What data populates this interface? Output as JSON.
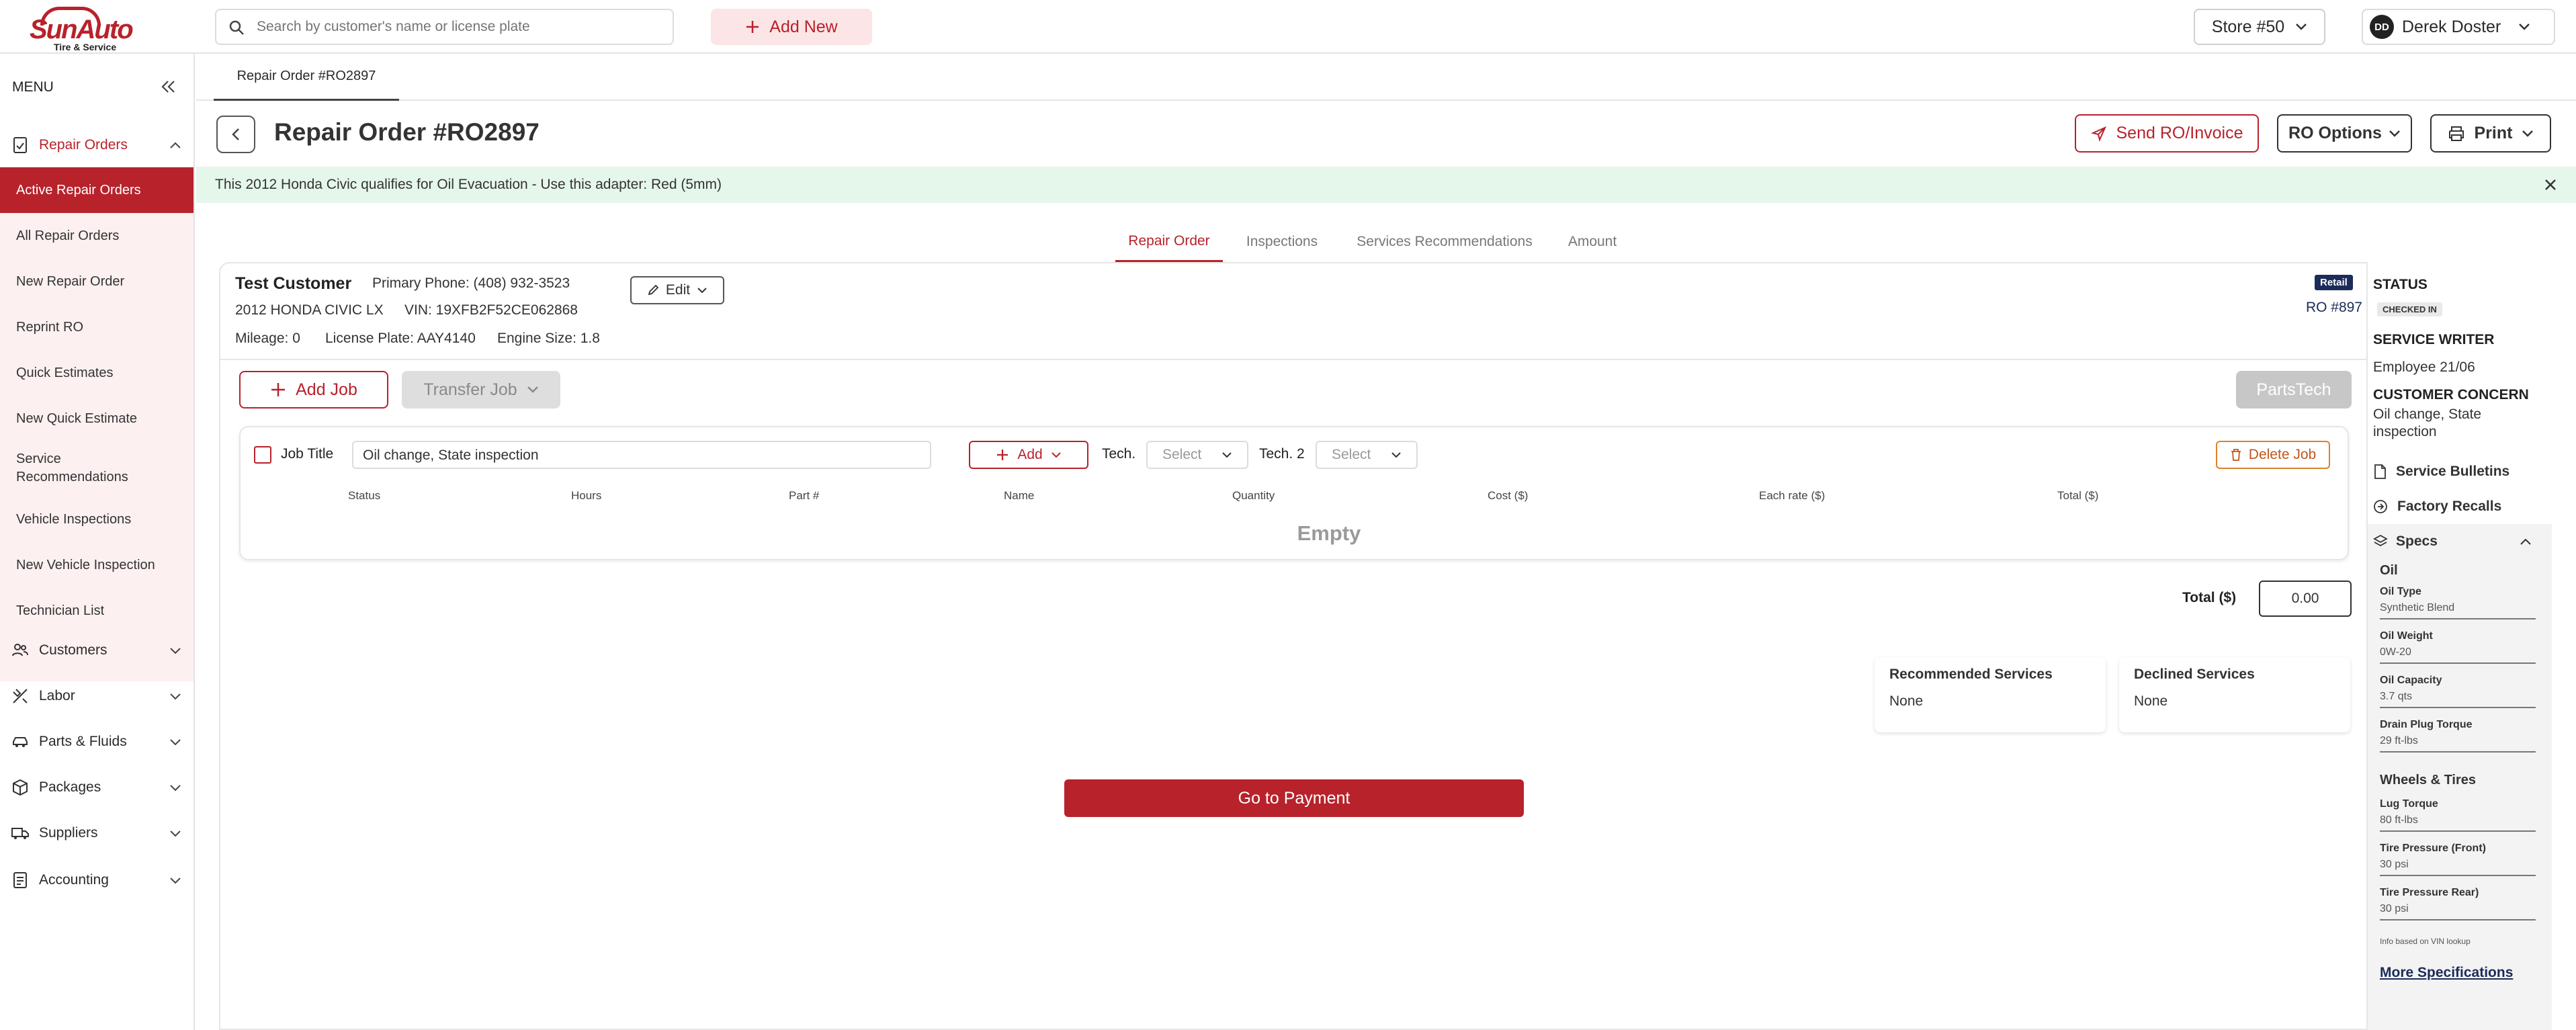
{
  "header": {
    "logo_text": "SunAuto",
    "logo_tagline": "Tire & Service",
    "search_placeholder": "Search by customer's name or license plate",
    "add_new_label": "Add New",
    "store_label": "Store #50",
    "user_initials": "DD",
    "user_name": "Derek Doster"
  },
  "sidebar": {
    "menu_label": "MENU",
    "repair_orders_label": "Repair Orders",
    "sub_items": [
      {
        "label": "Active Repair Orders",
        "active": true
      },
      {
        "label": "All Repair Orders"
      },
      {
        "label": "New Repair Order"
      },
      {
        "label": "Reprint RO"
      },
      {
        "label": "Quick Estimates"
      },
      {
        "label": "New Quick Estimate"
      },
      {
        "label": "Service Recommendations"
      },
      {
        "label": "Vehicle Inspections"
      },
      {
        "label": "New Vehicle Inspection"
      },
      {
        "label": "Technician List"
      }
    ],
    "groups": [
      {
        "label": "Customers",
        "icon": "customers-icon"
      },
      {
        "label": "Labor",
        "icon": "labor-icon"
      },
      {
        "label": "Parts & Fluids",
        "icon": "car-icon"
      },
      {
        "label": "Packages",
        "icon": "package-icon"
      },
      {
        "label": "Suppliers",
        "icon": "truck-icon"
      },
      {
        "label": "Accounting",
        "icon": "accounting-icon"
      }
    ]
  },
  "page_tab": "Repair Order #RO2897",
  "title": "Repair Order #RO2897",
  "actions": {
    "send": "Send RO/Invoice",
    "ro_options": "RO Options",
    "print": "Print"
  },
  "banner": "This 2012 Honda Civic qualifies for Oil Evacuation - Use this adapter: Red (5mm)",
  "content_tabs": [
    {
      "label": "Repair Order",
      "active": true
    },
    {
      "label": "Inspections"
    },
    {
      "label": "Services Recommendations"
    },
    {
      "label": "Amount"
    }
  ],
  "customer": {
    "name": "Test Customer",
    "phone": "Primary Phone: (408) 932-3523",
    "vehicle": "2012 HONDA CIVIC LX",
    "vin": "VIN: 19XFB2F52CE062868",
    "mileage": "Mileage: 0",
    "plate": "License Plate: AAY4140",
    "engine": "Engine Size: 1.8",
    "edit_label": "Edit",
    "type_badge": "Retail",
    "ro_number": "RO #897"
  },
  "job_actions": {
    "add_job": "Add Job",
    "transfer_job": "Transfer Job",
    "partstech": "PartsTech"
  },
  "job": {
    "title_label": "Job Title",
    "title_value": "Oil change,  State inspection",
    "add_label": "Add",
    "tech_label": "Tech.",
    "tech_select": "Select",
    "tech2_label": "Tech. 2",
    "tech2_select": "Select",
    "delete_label": "Delete Job",
    "columns": [
      "Status",
      "Hours",
      "Part #",
      "Name",
      "Quantity",
      "Cost ($)",
      "Each rate ($)",
      "Total ($)"
    ],
    "empty_text": "Empty"
  },
  "total": {
    "label": "Total ($)",
    "value": "0.00"
  },
  "recommended": {
    "title": "Recommended Services",
    "value": "None"
  },
  "declined": {
    "title": "Declined Services",
    "value": "None"
  },
  "go_to_payment": "Go to Payment",
  "right_panel": {
    "status_label": "STATUS",
    "status_value": "CHECKED IN",
    "writer_label": "SERVICE WRITER",
    "writer_value": "Employee 21/06",
    "concern_label": "CUSTOMER CONCERN",
    "concern_value": "Oil change, State inspection",
    "bulletins": "Service Bulletins",
    "recalls": "Factory Recalls",
    "specs_label": "Specs",
    "specs": {
      "oil_group": "Oil",
      "oil_type_k": "Oil Type",
      "oil_type_v": "Synthetic Blend",
      "oil_weight_k": "Oil Weight",
      "oil_weight_v": "0W-20",
      "oil_capacity_k": "Oil Capacity",
      "oil_capacity_v": "3.7 qts",
      "drain_k": "Drain Plug Torque",
      "drain_v": "29 ft-lbs",
      "wheels_group": "Wheels & Tires",
      "lug_k": "Lug Torque",
      "lug_v": "80 ft-lbs",
      "front_k": "Tire Pressure (Front)",
      "front_v": "30 psi",
      "rear_k": "Tire Pressure Rear)",
      "rear_v": "30 psi",
      "info": "Info based on VIN lookup",
      "more": "More Specifications"
    }
  },
  "colors": {
    "brand": "#b8222b",
    "navy": "#1b2b5a",
    "banner_bg": "#e5f6eb"
  }
}
